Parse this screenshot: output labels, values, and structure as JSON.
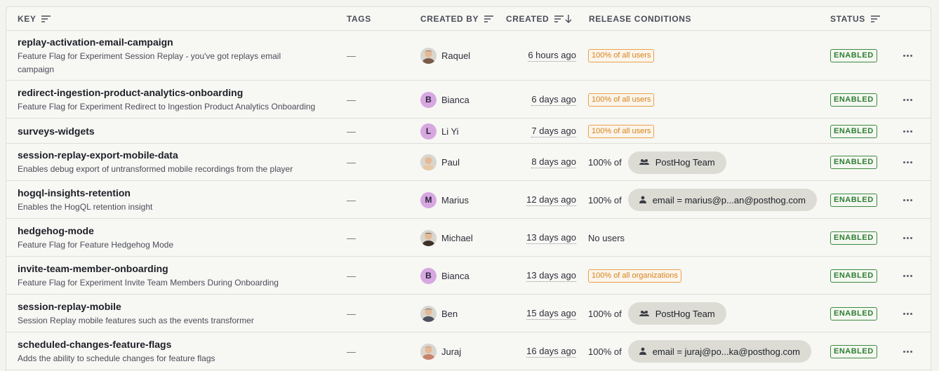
{
  "columns": {
    "key": "KEY",
    "tags": "TAGS",
    "created_by": "CREATED BY",
    "created": "CREATED",
    "release_conditions": "RELEASE CONDITIONS",
    "status": "STATUS"
  },
  "rows": [
    {
      "key": "replay-activation-email-campaign",
      "desc1": "Feature Flag for Experiment Session Replay - you've got replays email",
      "desc2": "campaign",
      "tags": "—",
      "creator": "Raquel",
      "avatar": "",
      "created": "6 hours ago",
      "release": {
        "type": "pill",
        "text": "100% of all users"
      },
      "status": "ENABLED"
    },
    {
      "key": "redirect-ingestion-product-analytics-onboarding",
      "desc1": "Feature Flag for Experiment Redirect to Ingestion Product Analytics Onboarding",
      "tags": "—",
      "creator": "Bianca",
      "avatar": "B",
      "created": "6 days ago",
      "release": {
        "type": "pill",
        "text": "100% of all users"
      },
      "status": "ENABLED"
    },
    {
      "key": "surveys-widgets",
      "desc1": "",
      "tags": "—",
      "creator": "Li Yi",
      "avatar": "L",
      "created": "7 days ago",
      "release": {
        "type": "pill",
        "text": "100% of all users"
      },
      "status": "ENABLED"
    },
    {
      "key": "session-replay-export-mobile-data",
      "desc1": "Enables debug export of untransformed mobile recordings from the player",
      "tags": "—",
      "creator": "Paul",
      "avatar": "",
      "created": "8 days ago",
      "release": {
        "type": "group",
        "prefix": "100% of",
        "text": "PostHog Team",
        "icon": "team-icon"
      },
      "status": "ENABLED"
    },
    {
      "key": "hogql-insights-retention",
      "desc1": "Enables the HogQL retention insight",
      "tags": "—",
      "creator": "Marius",
      "avatar": "M",
      "created": "12 days ago",
      "release": {
        "type": "group",
        "prefix": "100% of",
        "text": "email = marius@p...an@posthog.com",
        "icon": "person-icon"
      },
      "status": "ENABLED"
    },
    {
      "key": "hedgehog-mode",
      "desc1": "Feature Flag for Feature Hedgehog Mode",
      "tags": "—",
      "creator": "Michael",
      "avatar": "",
      "created": "13 days ago",
      "release": {
        "type": "text",
        "text": "No users"
      },
      "status": "ENABLED"
    },
    {
      "key": "invite-team-member-onboarding",
      "desc1": "Feature Flag for Experiment Invite Team Members During Onboarding",
      "tags": "—",
      "creator": "Bianca",
      "avatar": "B",
      "created": "13 days ago",
      "release": {
        "type": "pill",
        "text": "100% of all organizations"
      },
      "status": "ENABLED"
    },
    {
      "key": "session-replay-mobile",
      "desc1": "Session Replay mobile features such as the events transformer",
      "tags": "—",
      "creator": "Ben",
      "avatar": "",
      "created": "15 days ago",
      "release": {
        "type": "group",
        "prefix": "100% of",
        "text": "PostHog Team",
        "icon": "team-icon"
      },
      "status": "ENABLED"
    },
    {
      "key": "scheduled-changes-feature-flags",
      "desc1": "Adds the ability to schedule changes for feature flags",
      "tags": "—",
      "creator": "Juraj",
      "avatar": "",
      "created": "16 days ago",
      "release": {
        "type": "group",
        "prefix": "100% of",
        "text": "email = juraj@po...ka@posthog.com",
        "icon": "person-icon"
      },
      "status": "ENABLED"
    }
  ],
  "colors": {
    "status_green": "#2f7d32",
    "pill_orange": "#d9811a",
    "avatar_purple": "#d7a8e0"
  }
}
